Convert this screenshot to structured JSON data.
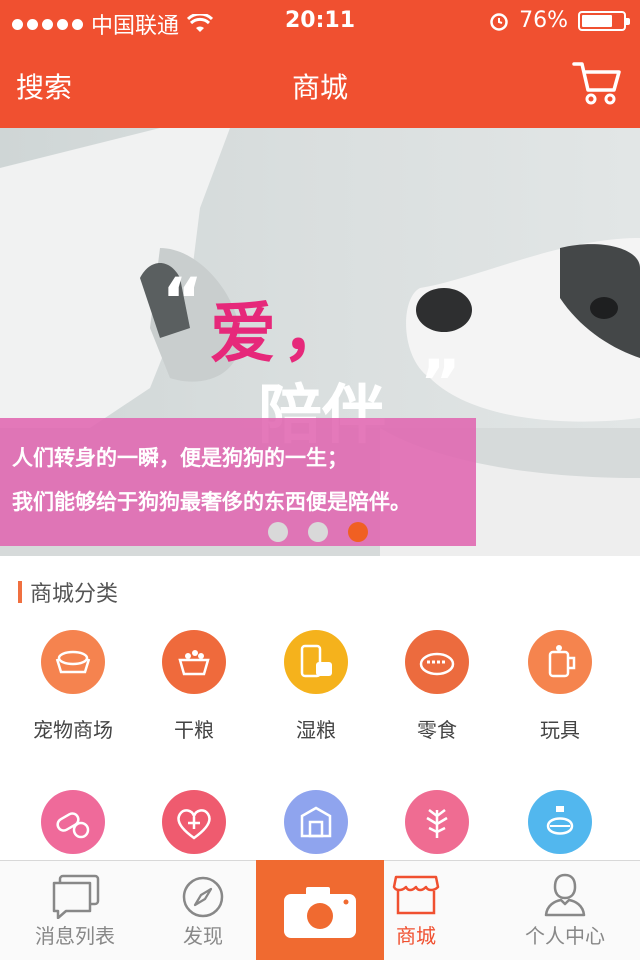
{
  "status_bar": {
    "carrier": "中国联通",
    "time": "20:11",
    "battery": "76%",
    "battery_level": 0.76
  },
  "nav": {
    "left": "搜索",
    "title": "商城",
    "right_icon": "cart-icon"
  },
  "banner": {
    "quote_open": "“",
    "quote_word": "爱",
    "quote_comma": "，",
    "quote_rest": "陪伴",
    "quote_close": "”",
    "caption_line1": "人们转身的一瞬，便是狗狗的一生；",
    "caption_line2": "我们能够给于狗狗最奢侈的东西便是陪伴。",
    "page_count": 3,
    "active_page": 3
  },
  "section": {
    "title": "商城分类"
  },
  "categories": [
    {
      "label": "宠物商场",
      "icon": "pet-bowl-icon",
      "color": "#f5834f"
    },
    {
      "label": "干粮",
      "icon": "dry-food-bowl-icon",
      "color": "#ef6a3c"
    },
    {
      "label": "湿粮",
      "icon": "canned-food-icon",
      "color": "#f5b21c"
    },
    {
      "label": "零食",
      "icon": "snack-plate-icon",
      "color": "#ec6b3e"
    },
    {
      "label": "玩具",
      "icon": "toy-cup-icon",
      "color": "#f5844e"
    },
    {
      "label": "",
      "icon": "pill-capsule-icon",
      "color": "#ef6a9a"
    },
    {
      "label": "",
      "icon": "heart-plus-icon",
      "color": "#ef5b6f"
    },
    {
      "label": "",
      "icon": "box-house-icon",
      "color": "#8fa4ee"
    },
    {
      "label": "",
      "icon": "tree-icon",
      "color": "#ef6c92"
    },
    {
      "label": "",
      "icon": "perfume-bottle-icon",
      "color": "#52b7ee"
    }
  ],
  "tabbar": {
    "tabs": [
      {
        "label": "消息列表",
        "icon": "chat-bubbles-icon"
      },
      {
        "label": "发现",
        "icon": "compass-icon"
      },
      {
        "label": "",
        "icon": "camera-icon"
      },
      {
        "label": "商城",
        "icon": "shop-icon"
      },
      {
        "label": "个人中心",
        "icon": "person-icon"
      }
    ],
    "active": "商城"
  }
}
